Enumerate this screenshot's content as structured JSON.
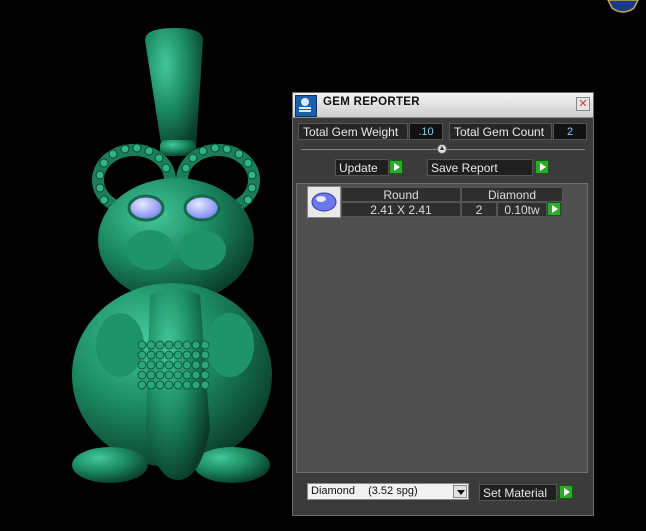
{
  "window": {
    "title": "GEM REPORTER"
  },
  "stats": {
    "total_weight_label": "Total Gem Weight",
    "total_weight_value": ".10",
    "total_count_label": "Total Gem Count",
    "total_count_value": "2"
  },
  "buttons": {
    "update_label": "Update",
    "save_report_label": "Save Report",
    "set_material_label": "Set Material"
  },
  "gem_table": {
    "headers": [
      "Round",
      "Diamond"
    ],
    "rows": [
      {
        "size": "2.41 X 2.41",
        "count": "2",
        "weight": "0.10tw"
      }
    ]
  },
  "material_select": {
    "name": "Diamond",
    "spg": "(3.52 spg)"
  },
  "colors": {
    "model": "#1e8a62",
    "accent": "#2fa82f",
    "gem_blue": "#7c88ff"
  },
  "icons": [
    "gem-reporter-icon",
    "close-icon",
    "splitter-arrow-icon",
    "gem-thumbnail",
    "go-arrow-icon",
    "dropdown-arrow-icon",
    "logo-icon"
  ]
}
